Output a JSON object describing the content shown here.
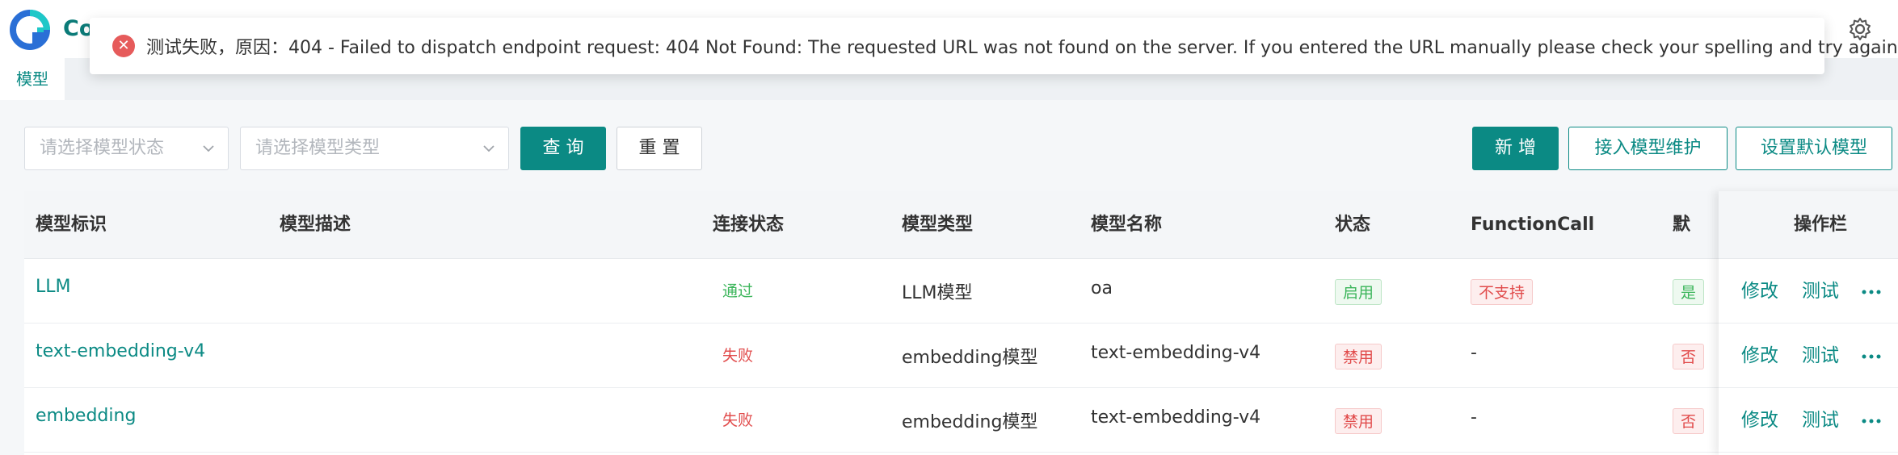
{
  "header": {
    "brand_text": "Co",
    "settings_icon": "gear-icon",
    "logo_icon": "app-logo-icon"
  },
  "tabs": [
    {
      "label": "模型"
    }
  ],
  "toast": {
    "icon": "error-circle-icon",
    "message": "测试失败，原因：404 - Failed to dispatch endpoint request: 404 Not Found: The requested URL was not found on the server. If you entered the URL manually please check your spelling and try again."
  },
  "filters": {
    "status_placeholder": "请选择模型状态",
    "type_placeholder": "请选择模型类型",
    "query_label": "查 询",
    "reset_label": "重 置"
  },
  "toolbar": {
    "add_label": "新 增",
    "maintain_label": "接入模型维护",
    "default_label": "设置默认模型"
  },
  "table": {
    "columns": [
      "模型标识",
      "模型描述",
      "连接状态",
      "模型类型",
      "模型名称",
      "状态",
      "FunctionCall",
      "默"
    ],
    "action_column": "操作栏",
    "rows": [
      {
        "id": "LLM",
        "desc": "",
        "conn": "通过",
        "conn_status": "ok",
        "type": "LLM模型",
        "name": "oa",
        "state": "启用",
        "state_status": "ok",
        "fc": "不支持",
        "fc_status": "bad",
        "default": "是"
      },
      {
        "id": "text-embedding-v4",
        "desc": "",
        "conn": "失败",
        "conn_status": "bad",
        "type": "embedding模型",
        "name": "text-embedding-v4",
        "state": "禁用",
        "state_status": "bad",
        "fc": "-",
        "fc_status": "",
        "default": "否"
      },
      {
        "id": "embedding",
        "desc": "",
        "conn": "失败",
        "conn_status": "bad",
        "type": "embedding模型",
        "name": "text-embedding-v4",
        "state": "禁用",
        "state_status": "bad",
        "fc": "-",
        "fc_status": "",
        "default": "否"
      }
    ],
    "actions": {
      "edit": "修改",
      "test": "测试",
      "more_icon": "more-dots-icon"
    }
  },
  "colors": {
    "primary": "#0b8a84",
    "success": "#3bb55a",
    "danger": "#e14b4b"
  }
}
